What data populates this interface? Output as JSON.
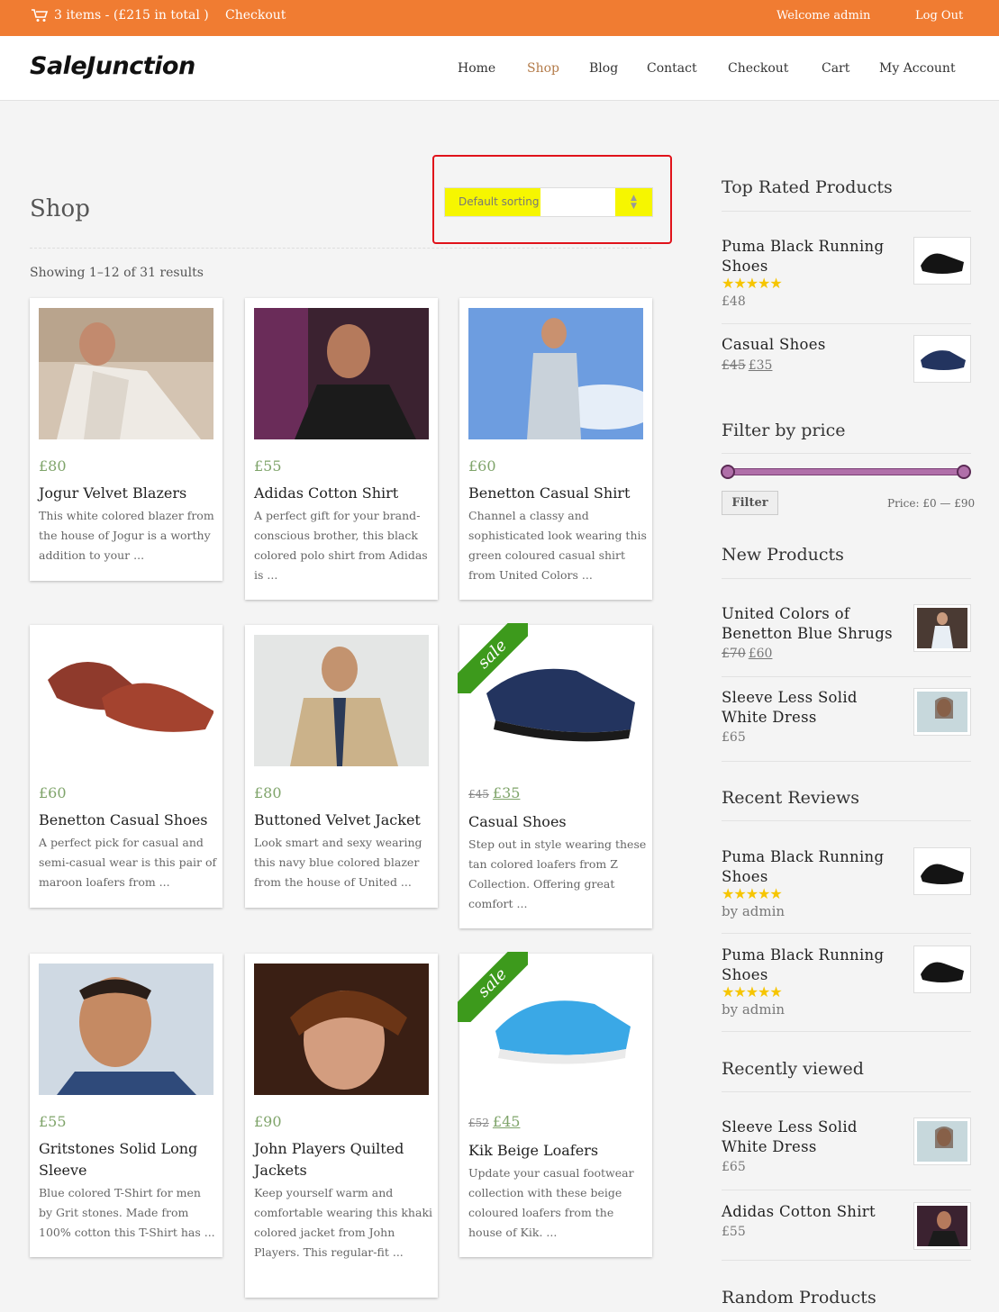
{
  "topbar": {
    "cart_summary": "3 items - (£215 in total )",
    "checkout": "Checkout",
    "welcome": "Welcome  admin",
    "logout": "Log Out"
  },
  "header": {
    "logo": "SaleJunction"
  },
  "nav": [
    "Home",
    "Shop",
    "Blog",
    "Contact",
    "Checkout",
    "Cart",
    "My Account"
  ],
  "shop": {
    "title": "Shop",
    "results": "Showing 1–12 of 31 results",
    "sort_label": "Default sorting"
  },
  "products": [
    {
      "price": "£80",
      "name": "Jogur Velvet Blazers",
      "desc": "This white colored blazer from the house of Jogur is a worthy addition to your ..."
    },
    {
      "price": "£55",
      "name": "Adidas Cotton Shirt",
      "desc": "A perfect gift for your brand-conscious brother, this black colored polo shirt from Adidas is ..."
    },
    {
      "price": "£60",
      "name": "Benetton Casual Shirt",
      "desc": "Channel a classy and sophisticated look wearing this green coloured casual shirt from United Colors ..."
    },
    {
      "price": "£60",
      "name": "Benetton Casual Shoes",
      "desc": "A perfect pick for casual and semi-casual wear is this pair of maroon loafers from ..."
    },
    {
      "price": "£80",
      "name": "Buttoned Velvet Jacket",
      "desc": "Look smart and sexy wearing this navy blue colored blazer from the house of United ..."
    },
    {
      "old_price": "£45",
      "price": "£35",
      "name": "Casual Shoes",
      "sale": "sale",
      "desc": "Step out in style wearing these tan colored loafers from Z Collection. Offering great comfort ..."
    },
    {
      "price": "£55",
      "name": "Gritstones Solid Long Sleeve",
      "desc": "Blue colored T-Shirt for men by Grit stones. Made from 100% cotton this T-Shirt has ..."
    },
    {
      "price": "£90",
      "name": "John Players Quilted Jackets",
      "desc": "Keep yourself warm and comfortable wearing this khaki colored jacket from John Players. This regular-fit ..."
    },
    {
      "old_price": "£52",
      "price": "£45",
      "name": "Kik Beige Loafers",
      "sale": "sale",
      "desc": "Update your casual footwear collection with these beige coloured loafers from the house of Kik. ..."
    }
  ],
  "sidebar": {
    "top_rated": {
      "title": "Top Rated Products",
      "items": [
        {
          "name": "Puma Black Running Shoes",
          "stars": "★★★★★",
          "price": "£48"
        },
        {
          "name": "Casual Shoes",
          "old_price": "£45",
          "price": "£35"
        }
      ]
    },
    "filter": {
      "title": "Filter by price",
      "button": "Filter",
      "range": "Price: £0 — £90"
    },
    "new_products": {
      "title": "New Products",
      "items": [
        {
          "name": "United Colors of Benetton Blue Shrugs",
          "old_price": "£70",
          "price": "£60"
        },
        {
          "name": "Sleeve Less Solid White Dress",
          "price": "£65"
        }
      ]
    },
    "reviews": {
      "title": "Recent Reviews",
      "items": [
        {
          "name": "Puma Black Running Shoes",
          "stars": "★★★★★",
          "by": "by admin"
        },
        {
          "name": "Puma Black Running Shoes",
          "stars": "★★★★★",
          "by": "by admin"
        }
      ]
    },
    "recent": {
      "title": "Recently viewed",
      "items": [
        {
          "name": "Sleeve Less Solid White Dress",
          "price": "£65"
        },
        {
          "name": "Adidas Cotton Shirt",
          "price": "£55"
        }
      ]
    },
    "random": {
      "title": "Random Products"
    }
  }
}
